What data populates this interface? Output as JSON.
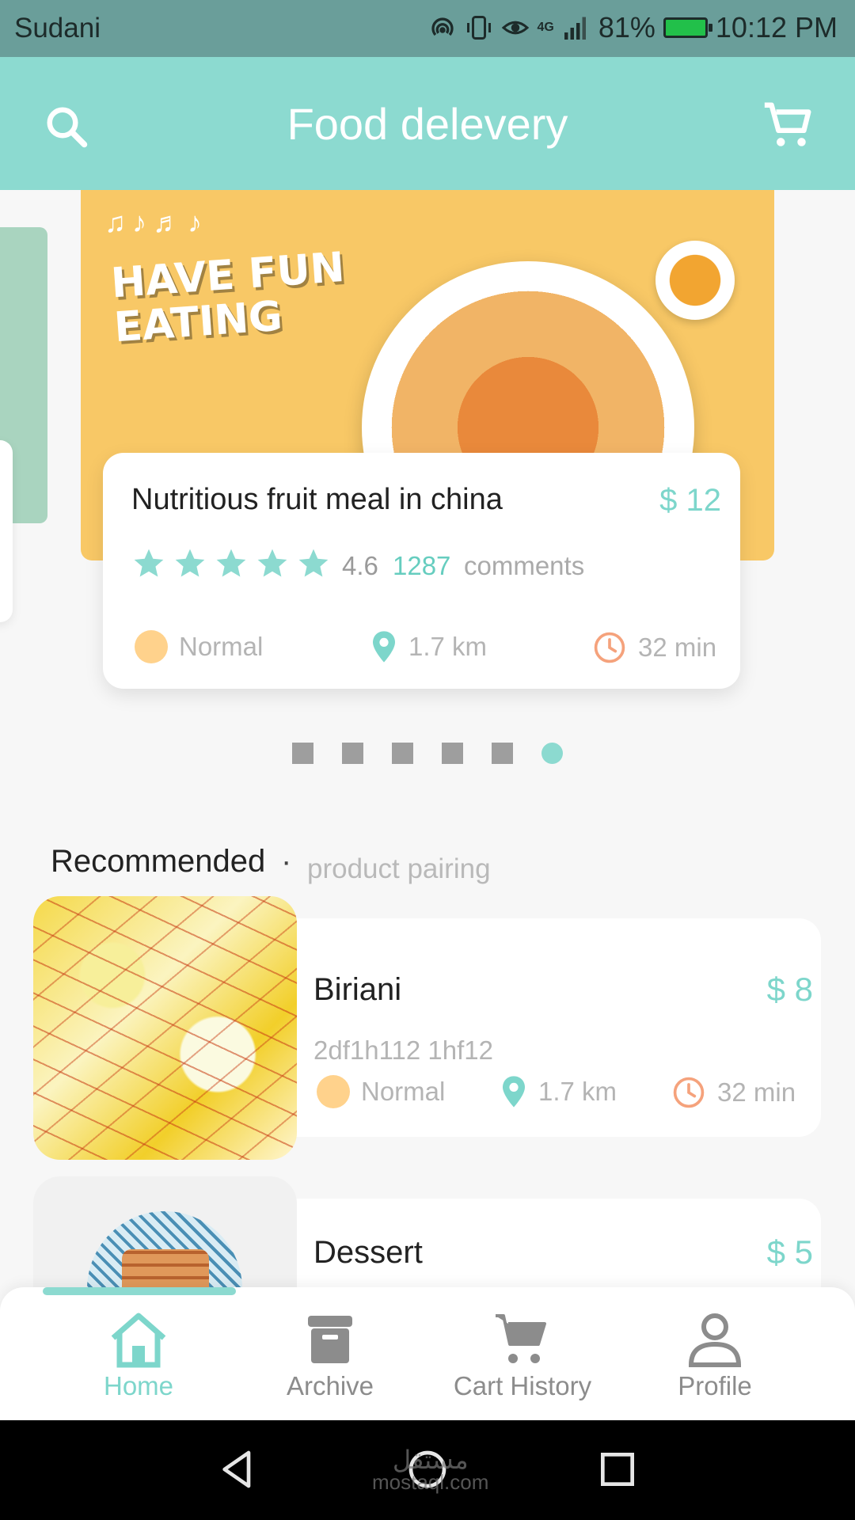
{
  "status_bar": {
    "carrier": "Sudani",
    "battery": "81%",
    "network": "4G",
    "time": "10:12 PM"
  },
  "header": {
    "title": "Food delevery",
    "search_icon": "search-icon",
    "cart_icon": "cart-icon"
  },
  "banner": {
    "headline": "HAVE FUN EATING"
  },
  "featured": {
    "name": "Nutritious fruit meal in china",
    "price": "$ 12",
    "stars": 5,
    "rating": "4.6",
    "comment_count": "1287",
    "comments_label": "comments",
    "level": "Normal",
    "distance": "1.7 km",
    "time": "32 min"
  },
  "pager": {
    "pages": 6,
    "active_index": 5
  },
  "recommended": {
    "title": "Recommended",
    "separator": "·",
    "subtitle": "product pairing",
    "items": [
      {
        "name": "Biriani",
        "price": "$ 8",
        "code": "2df1h112 1hf12",
        "level": "Normal",
        "distance": "1.7 km",
        "time": "32 min"
      },
      {
        "name": "Dessert",
        "price": "$ 5"
      }
    ]
  },
  "tabs": [
    {
      "label": "Home",
      "icon": "home-icon",
      "active": true
    },
    {
      "label": "Archive",
      "icon": "archive-icon",
      "active": false
    },
    {
      "label": "Cart History",
      "icon": "cart-icon",
      "active": false
    },
    {
      "label": "Profile",
      "icon": "profile-icon",
      "active": false
    }
  ],
  "watermark": {
    "brand": "مستقل",
    "domain": "mostaql.com"
  },
  "colors": {
    "accent": "#8cdad0",
    "price": "#7dd6cb",
    "status_bar": "#6a9e9a",
    "banner": "#f8c866"
  }
}
